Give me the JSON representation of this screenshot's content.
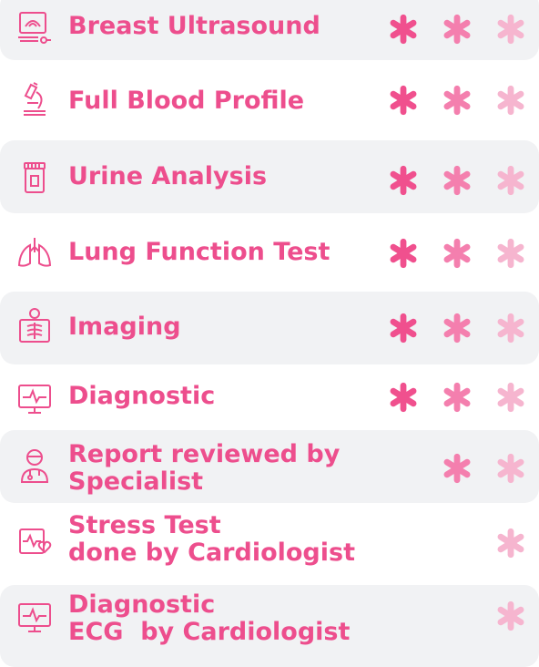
{
  "colors": {
    "accent": "#ed4e8d",
    "star_dark": "#f0508e",
    "star_mid": "#f47fae",
    "star_light": "#f6b5cf",
    "row_shade": "#f1f2f4"
  },
  "rows": [
    {
      "label": "Breast Ultrasound",
      "icon": "ultrasound-icon",
      "stars": [
        3,
        2,
        1
      ]
    },
    {
      "label": "Full Blood Profile",
      "icon": "microscope-icon",
      "stars": [
        3,
        2,
        1
      ]
    },
    {
      "label": "Urine Analysis",
      "icon": "sample-container-icon",
      "stars": [
        3,
        2,
        1
      ]
    },
    {
      "label": "Lung Function Test",
      "icon": "lungs-icon",
      "stars": [
        3,
        2,
        1
      ]
    },
    {
      "label": "Imaging",
      "icon": "xray-icon",
      "stars": [
        3,
        2,
        1
      ]
    },
    {
      "label": "Diagnostic",
      "icon": "ecg-monitor-icon",
      "stars": [
        3,
        2,
        1
      ]
    },
    {
      "label_line1": "Report reviewed by",
      "label_line2": "Specialist",
      "icon": "doctor-icon",
      "stars": [
        2,
        1
      ]
    },
    {
      "label_line1": "Stress Test",
      "label_line2": "done by Cardiologist",
      "icon": "heart-monitor-icon",
      "stars": [
        1
      ]
    },
    {
      "label_line1": "Diagnostic",
      "label_line2": "ECG  by Cardiologist",
      "icon": "ecg-monitor-icon",
      "stars": [
        1
      ]
    }
  ]
}
